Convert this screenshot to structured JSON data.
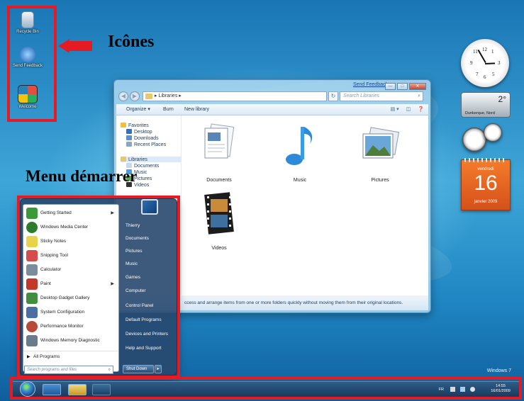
{
  "annotations": {
    "icons_label": "Icônes",
    "start_menu_label": "Menu démarrer"
  },
  "desktop": {
    "icons": [
      {
        "label": "Recycle Bin",
        "icon": "recycle-bin-icon"
      },
      {
        "label": "Send Feedback",
        "icon": "feedback-icon"
      },
      {
        "label": "Welcome",
        "icon": "welcome-icon"
      }
    ],
    "watermark": "Windows 7"
  },
  "explorer": {
    "send_feedback": "Send Feedback",
    "address": "Libraries",
    "search_placeholder": "Search Libraries",
    "toolbar": {
      "organize": "Organize ▾",
      "burn": "Burn",
      "new_library": "New library"
    },
    "nav": {
      "favorites": "Favorites",
      "desktop": "Desktop",
      "downloads": "Downloads",
      "recent": "Recent Places",
      "libraries": "Libraries",
      "documents": "Documents",
      "music": "Music",
      "pictures": "Pictures",
      "videos": "Videos"
    },
    "libraries": [
      {
        "label": "Documents"
      },
      {
        "label": "Music"
      },
      {
        "label": "Pictures"
      },
      {
        "label": "Videos"
      }
    ],
    "details_text": "ccess and arrange items from one or more folders quickly without moving them from their original locations."
  },
  "gadgets": {
    "clock": {
      "hour": 14,
      "minute": 55,
      "numerals": [
        "12",
        "1",
        "3",
        "5",
        "6",
        "7",
        "9",
        "11"
      ]
    },
    "weather": {
      "temp": "2°",
      "place": "Dunkerque, Nord"
    },
    "calendar": {
      "weekday": "vendredi",
      "day": "16",
      "month": "janvier 2009"
    }
  },
  "start_menu": {
    "programs": [
      {
        "label": "Getting Started",
        "submenu": true,
        "color": "#3a9a3a"
      },
      {
        "label": "Windows Media Center",
        "submenu": false,
        "color": "#2b7d2b"
      },
      {
        "label": "Sticky Notes",
        "submenu": false,
        "color": "#e8d44a"
      },
      {
        "label": "Snipping Tool",
        "submenu": false,
        "color": "#d64b4b"
      },
      {
        "label": "Calculator",
        "submenu": false,
        "color": "#7a8c9e"
      },
      {
        "label": "Paint",
        "submenu": true,
        "color": "#c0392b"
      },
      {
        "label": "Desktop Gadget Gallery",
        "submenu": false,
        "color": "#3f8f3f"
      },
      {
        "label": "System Configuration",
        "submenu": false,
        "color": "#4a6fa5"
      },
      {
        "label": "Performance Monitor",
        "submenu": false,
        "color": "#b84a3a"
      },
      {
        "label": "Windows Memory Diagnostic",
        "submenu": false,
        "color": "#6a7b8c"
      }
    ],
    "all_programs": "All Programs",
    "search_placeholder": "Search programs and files",
    "places": [
      "Thierry",
      "Documents",
      "Pictures",
      "Music",
      "Games",
      "Computer",
      "Control Panel",
      "Default Programs",
      "Devices and Printers",
      "Help and Support"
    ],
    "shutdown": "Shut Down"
  },
  "taskbar": {
    "language": "FR",
    "time": "14:55",
    "date": "16/01/2009"
  }
}
